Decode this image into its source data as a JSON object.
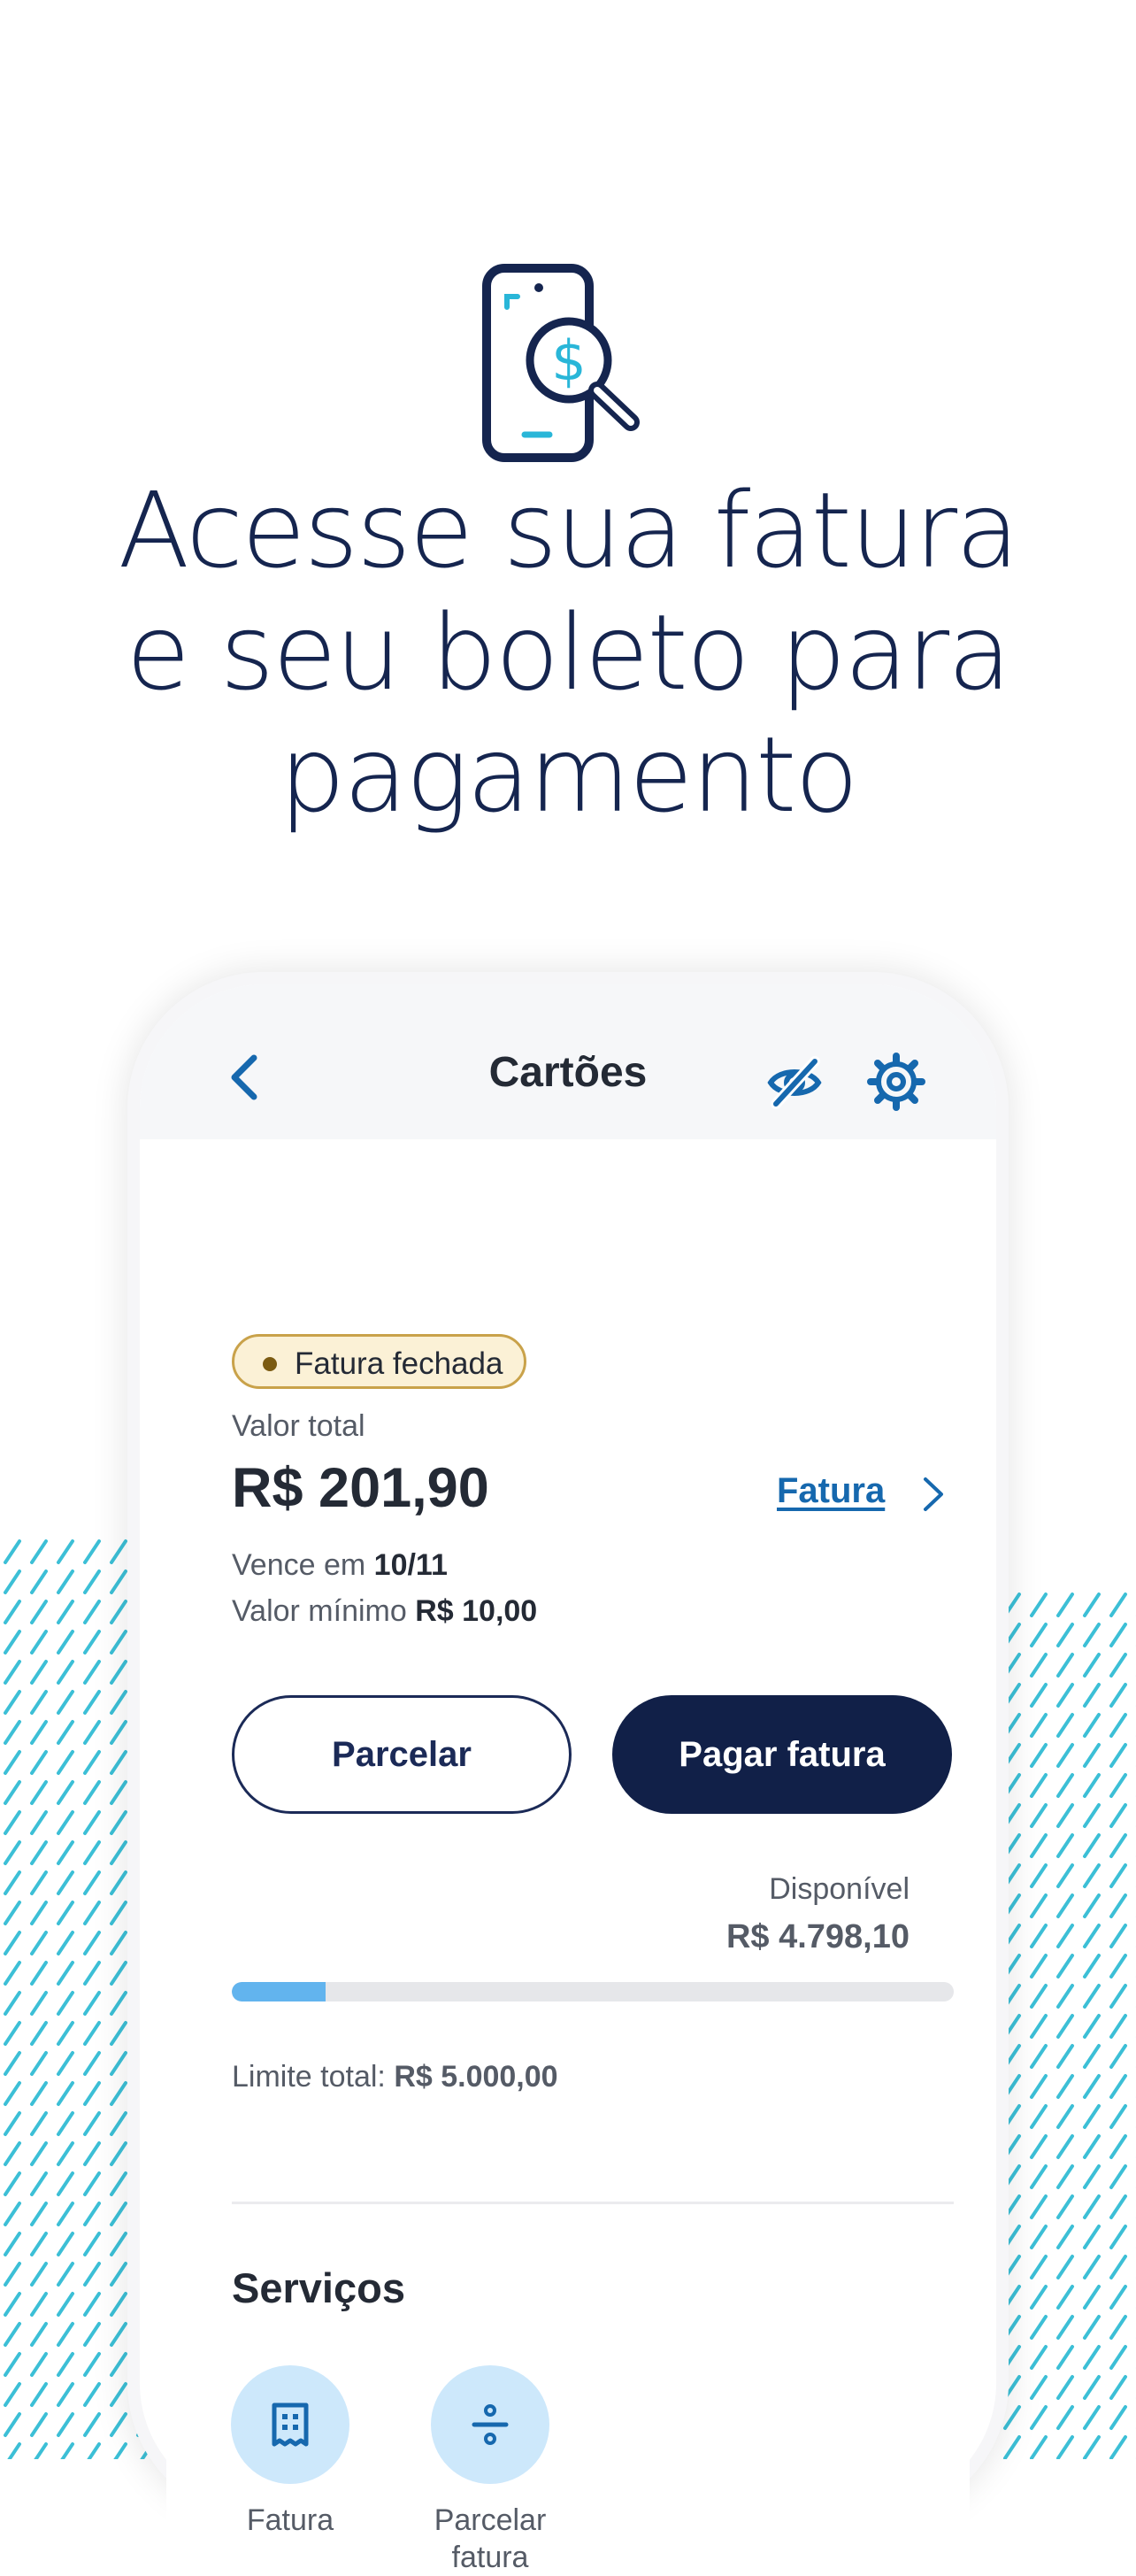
{
  "headline": [
    "Acesse sua fatura",
    "e seu boleto para",
    "pagamento"
  ],
  "screen": {
    "title": "Cartões",
    "icons": [
      "chevron-left-icon",
      "eye-off-icon",
      "gear-icon"
    ]
  },
  "invoice": {
    "status_badge": "Fatura fechada",
    "total_label": "Valor total",
    "total_amount": "R$ 201,90",
    "link_label": "Fatura",
    "due_prefix": "Vence em",
    "due_date": "10/11",
    "min_prefix": "Valor mínimo",
    "min_amount": "R$ 10,00"
  },
  "actions": {
    "parcelar": "Parcelar",
    "pagar": "Pagar fatura"
  },
  "limit": {
    "available_label": "Disponível",
    "available_value": "R$ 4.798,10",
    "used_fraction": 0.13,
    "total_prefix": "Limite total:",
    "total_value": "R$ 5.000,00"
  },
  "services": {
    "title": "Serviços",
    "items": [
      {
        "label": "Fatura",
        "icon": "receipt-icon"
      },
      {
        "label": "Parcelar fatura",
        "icon": "divide-icon"
      }
    ]
  },
  "colors": {
    "navy": "#112048",
    "accent_blue": "#1668ae",
    "cyan": "#29b6d8",
    "progress": "#62b4ee",
    "badge_border": "#c9a24a"
  }
}
